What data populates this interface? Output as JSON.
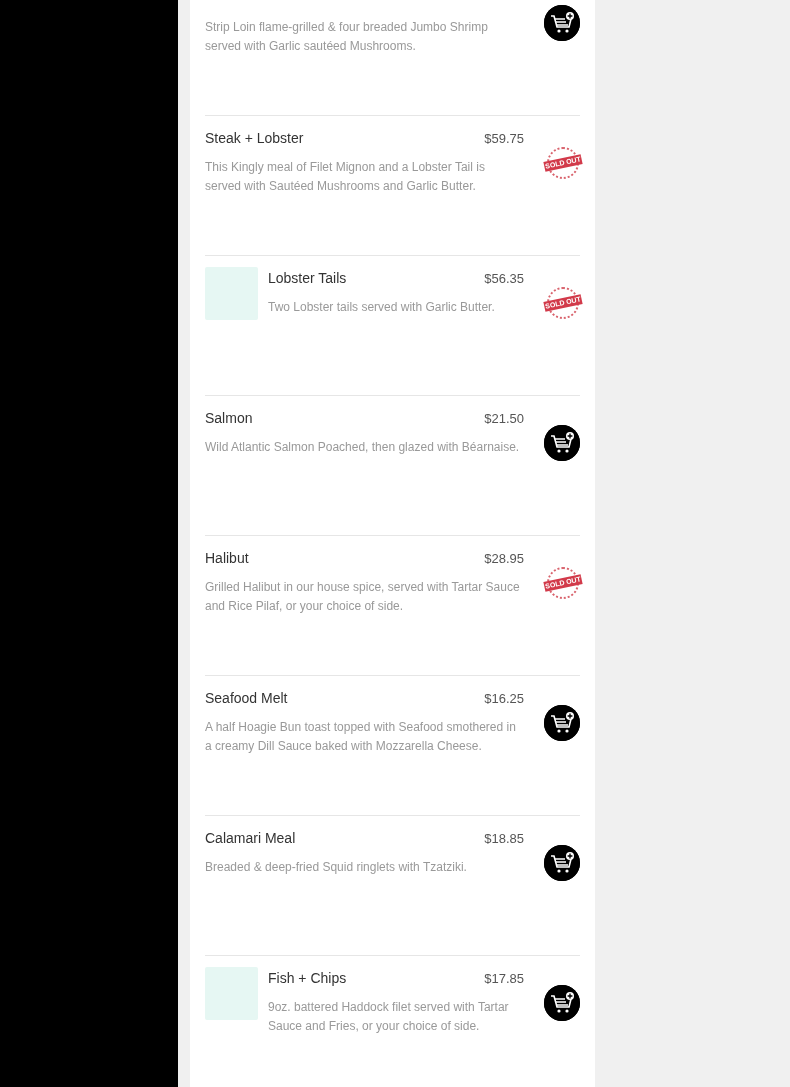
{
  "menu_items": [
    {
      "description": "Strip Loin flame-grilled & four breaded Jumbo Shrimp served with Garlic sautéed Mushrooms.",
      "has_image": false,
      "sold_out": false
    },
    {
      "name": "Steak + Lobster",
      "price": "$59.75",
      "description": "This Kingly meal of Filet Mignon and a Lobster Tail is served with Sautéed Mushrooms and Garlic Butter.",
      "has_image": false,
      "sold_out": true,
      "stamp_text": "SOLD OUT"
    },
    {
      "name": "Lobster Tails",
      "price": "$56.35",
      "description": "Two Lobster tails served with Garlic Butter.",
      "has_image": true,
      "sold_out": true,
      "stamp_text": "SOLD OUT"
    },
    {
      "name": "Salmon",
      "price": "$21.50",
      "description": "Wild Atlantic Salmon Poached, then glazed with Béarnaise.",
      "has_image": false,
      "sold_out": false
    },
    {
      "name": "Halibut",
      "price": "$28.95",
      "description": "Grilled Halibut in our house spice, served with Tartar Sauce and Rice Pilaf, or your choice of side.",
      "has_image": false,
      "sold_out": true,
      "stamp_text": "SOLD OUT"
    },
    {
      "name": "Seafood Melt",
      "price": "$16.25",
      "description": "A half Hoagie Bun toast topped with Seafood smothered in a creamy Dill Sauce baked with Mozzarella Cheese.",
      "has_image": false,
      "sold_out": false
    },
    {
      "name": "Calamari Meal",
      "price": "$18.85",
      "description": "Breaded & deep-fried Squid ringlets with Tzatziki.",
      "has_image": false,
      "sold_out": false
    },
    {
      "name": "Fish + Chips",
      "price": "$17.85",
      "description": "9oz. battered Haddock filet served with Tartar Sauce and Fries, or your choice of side.",
      "has_image": true,
      "sold_out": false
    }
  ]
}
